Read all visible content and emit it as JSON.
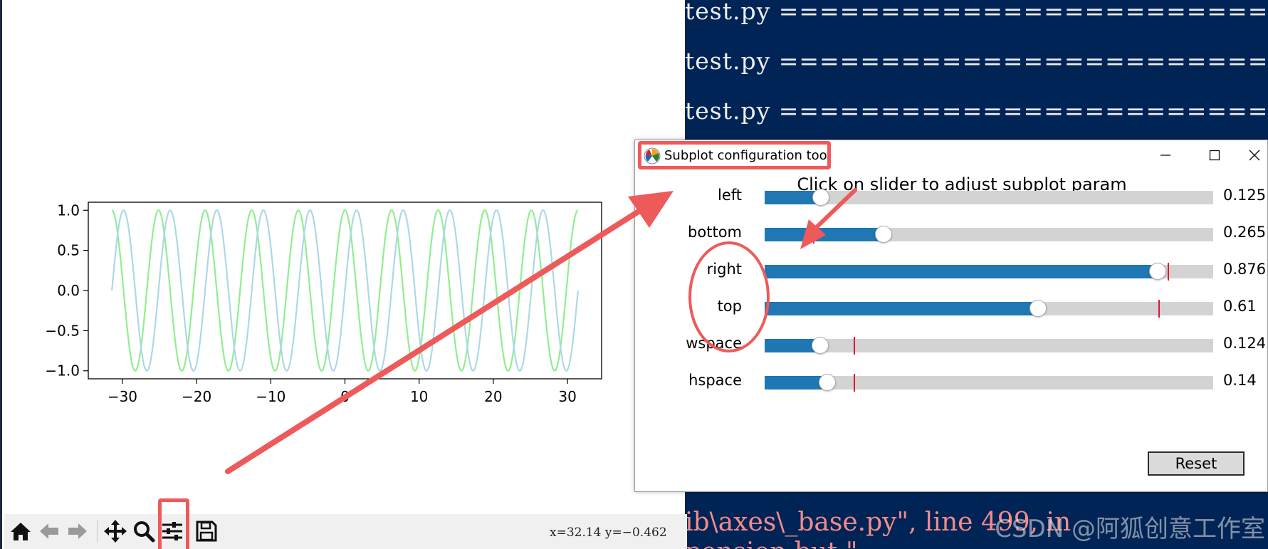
{
  "terminal": {
    "lines": [
      "test.py =============================",
      "test.py =============================",
      "test.py ============================="
    ],
    "error_lines": [
      "ib\\axes\\_base.py\", line 499, in",
      "pension  but \""
    ],
    "watermark": "CSDN @阿狐创意工作室"
  },
  "figure": {
    "y_ticks": [
      "1.0",
      "0.5",
      "0.0",
      "−0.5",
      "−1.0"
    ],
    "x_ticks": [
      "−30",
      "−20",
      "−10",
      "0",
      "10",
      "20",
      "30"
    ],
    "x_range": [
      -34.6,
      34.6
    ],
    "y_range": [
      -1.1,
      1.1
    ],
    "series": [
      {
        "function": "cos",
        "x_start": -31.416,
        "x_end": 31.416,
        "color": "#90ee90"
      },
      {
        "function": "sin",
        "x_start": -31.416,
        "x_end": 31.416,
        "color": "#add8e6"
      }
    ]
  },
  "toolbar": {
    "icons": [
      "home-icon",
      "back-icon",
      "forward-icon",
      "pan-icon",
      "zoom-icon",
      "subplots-icon",
      "save-icon"
    ],
    "coords": "x=32.14  y=−0.462"
  },
  "dialog": {
    "title": "Subplot configuration tool",
    "instruction": "Click on slider to adjust subplot param",
    "sliders": [
      {
        "label": "left",
        "value_text": "0.125",
        "value": 0.125,
        "ref": null
      },
      {
        "label": "bottom",
        "value_text": "0.265",
        "value": 0.265,
        "ref": 0.11
      },
      {
        "label": "right",
        "value_text": "0.876",
        "value": 0.876,
        "ref": 0.9
      },
      {
        "label": "top",
        "value_text": "0.61",
        "value": 0.61,
        "ref": 0.88
      },
      {
        "label": "wspace",
        "value_text": "0.124",
        "value": 0.124,
        "ref": 0.2
      },
      {
        "label": "hspace",
        "value_text": "0.14",
        "value": 0.14,
        "ref": 0.2
      }
    ],
    "reset_label": "Reset"
  },
  "annotation_color": "#ee5a5a"
}
